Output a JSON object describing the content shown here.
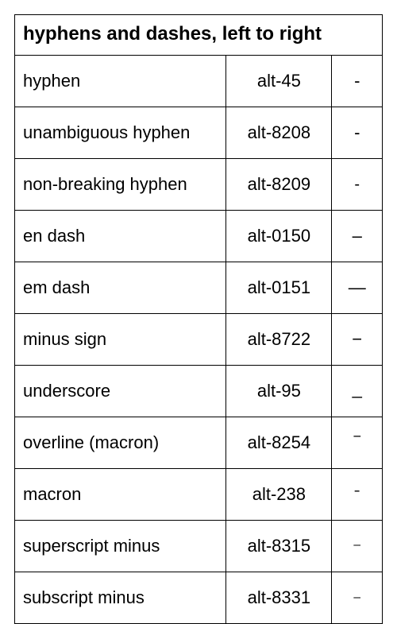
{
  "table": {
    "title": "hyphens and dashes, left to right",
    "rows": [
      {
        "name": "hyphen",
        "alt": "alt-45",
        "glyph": "-"
      },
      {
        "name": "unambiguous hyphen",
        "alt": "alt-8208",
        "glyph": "‐"
      },
      {
        "name": "non-breaking hyphen",
        "alt": "alt-8209",
        "glyph": "‑"
      },
      {
        "name": "en dash",
        "alt": "alt-0150",
        "glyph": "–"
      },
      {
        "name": "em dash",
        "alt": "alt-0151",
        "glyph": "—"
      },
      {
        "name": "minus sign",
        "alt": "alt-8722",
        "glyph": "−"
      },
      {
        "name": "underscore",
        "alt": "alt-95",
        "glyph": "_"
      },
      {
        "name": "overline (macron)",
        "alt": "alt-8254",
        "glyph": "‾"
      },
      {
        "name": "macron",
        "alt": "alt-238",
        "glyph": "ˉ"
      },
      {
        "name": "superscript minus",
        "alt": "alt-8315",
        "glyph": "⁻"
      },
      {
        "name": "subscript minus",
        "alt": "alt-8331",
        "glyph": "₋"
      }
    ]
  }
}
